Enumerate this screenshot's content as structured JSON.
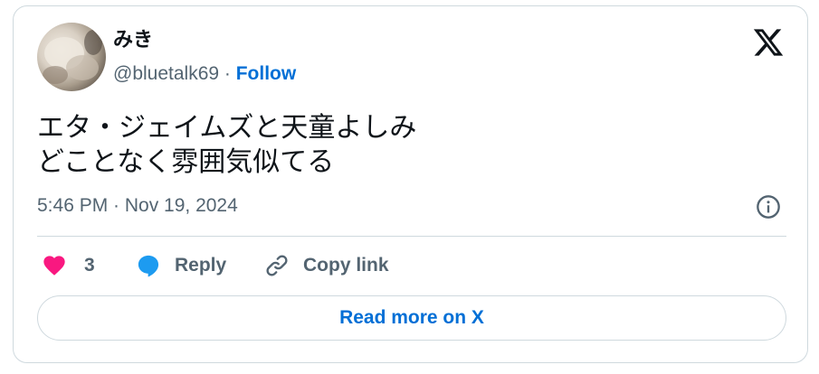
{
  "author": {
    "name": "みき",
    "handle": "@bluetalk69",
    "separator": " · ",
    "follow_label": "Follow"
  },
  "tweet": {
    "lines": [
      "エタ・ジェイムズと天童よしみ",
      "どことなく雰囲気似てる"
    ],
    "timestamp": "5:46 PM · Nov 19, 2024"
  },
  "actions": {
    "like_count": "3",
    "reply_label": "Reply",
    "copy_link_label": "Copy link"
  },
  "read_more_label": "Read more on X",
  "icons": {
    "brand": "x-logo-icon",
    "info": "info-icon",
    "like": "heart-icon",
    "reply": "speech-bubble-icon",
    "copy": "link-icon"
  },
  "colors": {
    "link": "#006fd6",
    "heart": "#f91880",
    "reply_bubble": "#1d9bf0",
    "secondary_text": "#536471",
    "border": "#cfd9de"
  }
}
